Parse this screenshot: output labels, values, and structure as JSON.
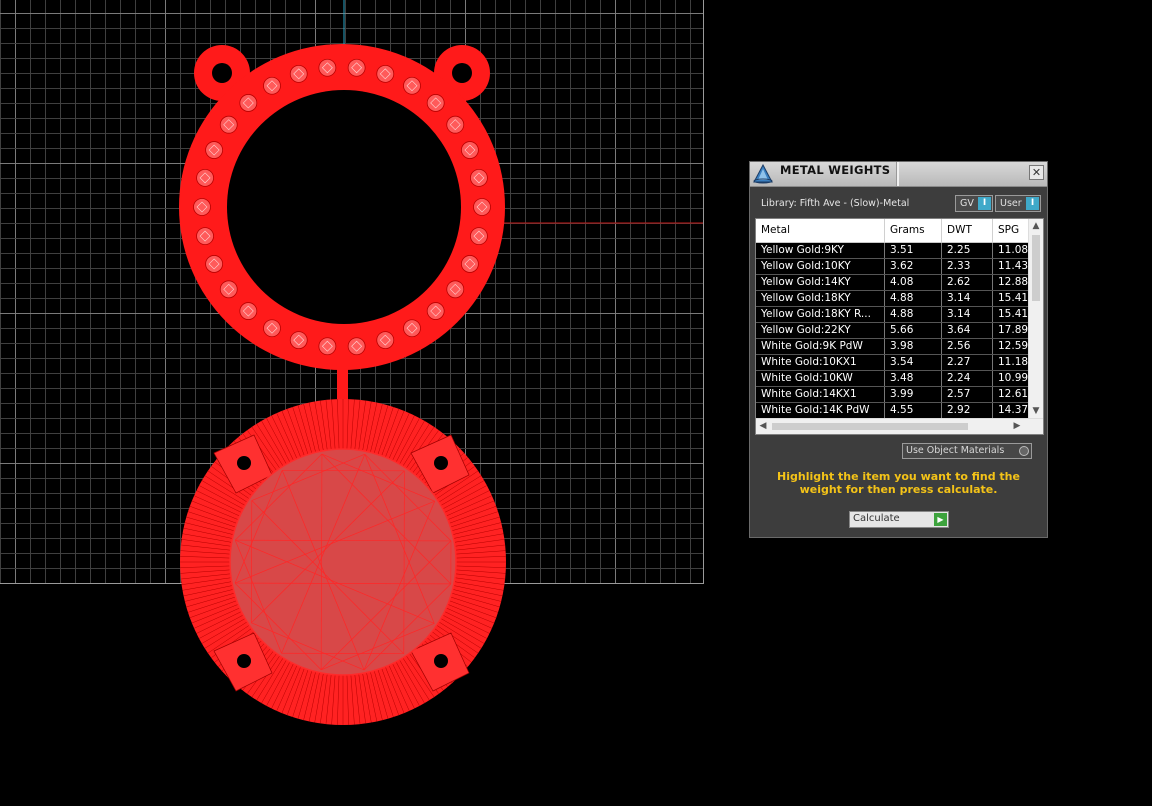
{
  "panel": {
    "title": "METAL WEIGHTS",
    "close_label": "✕",
    "library_label": "Library: Fifth Ave - (Slow)-Metal",
    "toggle_gv": "GV",
    "toggle_user": "User",
    "toggle_glyph": "I",
    "table": {
      "headers": [
        "Metal",
        "Grams",
        "DWT",
        "SPG"
      ],
      "rows": [
        [
          "Yellow Gold:9KY",
          "3.51",
          "2.25",
          "11.08"
        ],
        [
          "Yellow Gold:10KY",
          "3.62",
          "2.33",
          "11.43"
        ],
        [
          "Yellow Gold:14KY",
          "4.08",
          "2.62",
          "12.88"
        ],
        [
          "Yellow Gold:18KY",
          "4.88",
          "3.14",
          "15.41"
        ],
        [
          "Yellow Gold:18KY R...",
          "4.88",
          "3.14",
          "15.41"
        ],
        [
          "Yellow Gold:22KY",
          "5.66",
          "3.64",
          "17.89"
        ],
        [
          "White Gold:9K PdW",
          "3.98",
          "2.56",
          "12.59"
        ],
        [
          "White Gold:10KX1",
          "3.54",
          "2.27",
          "11.18"
        ],
        [
          "White Gold:10KW",
          "3.48",
          "2.24",
          "10.99"
        ],
        [
          "White Gold:14KX1",
          "3.99",
          "2.57",
          "12.61"
        ],
        [
          "White Gold:14K PdW",
          "4.55",
          "2.92",
          "14.37"
        ]
      ]
    },
    "scroll_up": "▲",
    "scroll_down": "▼",
    "scroll_left": "◀",
    "scroll_right": "▶",
    "use_object_materials": "Use Object Materials",
    "hint": "Highlight the item you want to find the weight for then press calculate.",
    "calculate_label": "Calculate",
    "calculate_glyph": "▶"
  },
  "colors": {
    "model_red": "#ff1a1a",
    "grid_line": "#4a4a4a",
    "axis_x": "#c01818",
    "axis_y": "#2aa6c8",
    "hint_yellow": "#f4c318"
  },
  "icons": {
    "app": "app-logo-icon",
    "close": "close-icon"
  }
}
